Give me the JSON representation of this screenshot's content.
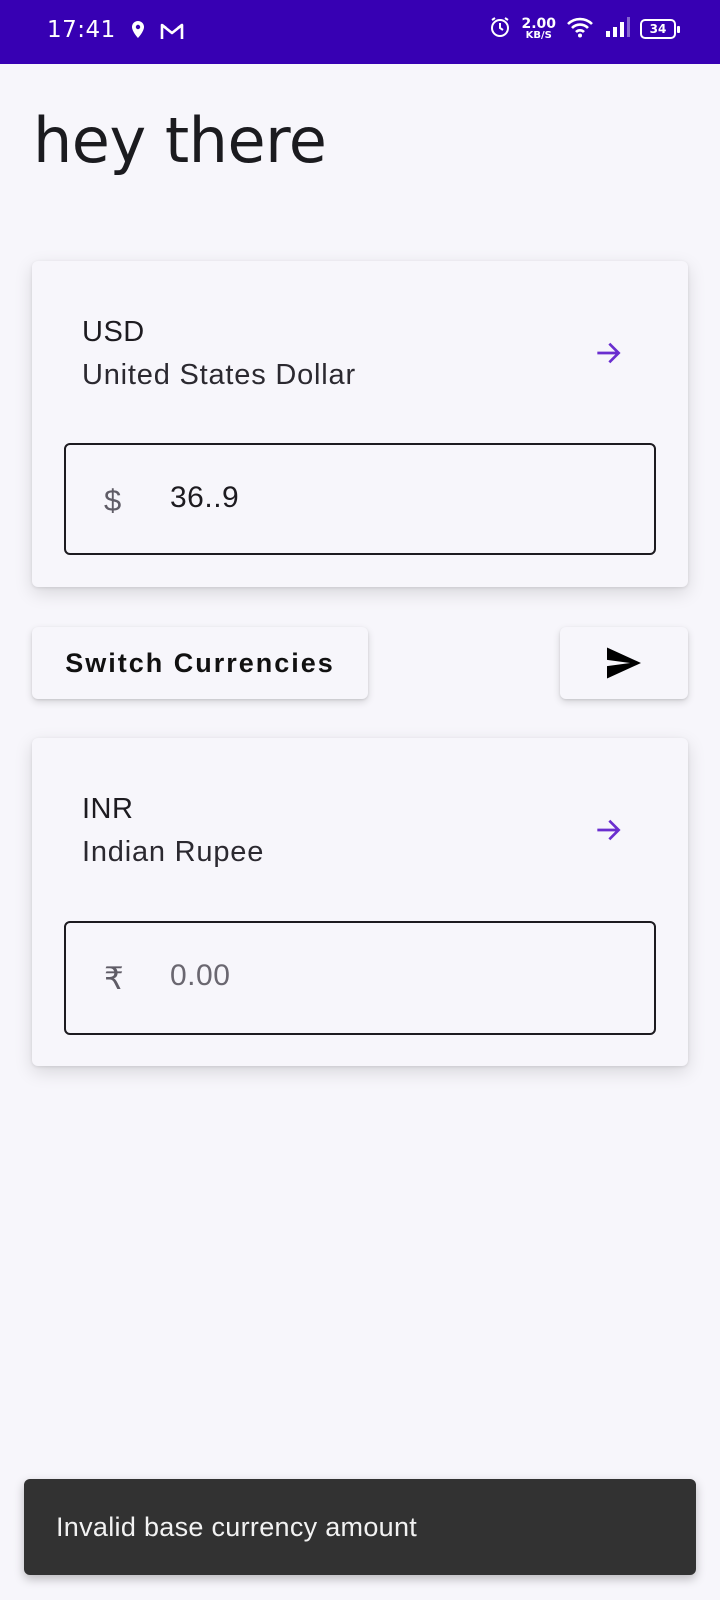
{
  "status_bar": {
    "time": "17:41",
    "speed_value": "2.00",
    "speed_unit": "KB/S",
    "battery": "34",
    "icons": [
      "location-icon",
      "gmail-icon",
      "alarm-icon",
      "wifi-icon",
      "signal-icon",
      "battery-icon"
    ]
  },
  "greeting": "hey there",
  "base_card": {
    "code": "USD",
    "name": "United States Dollar",
    "symbol": "$",
    "amount": "36..9"
  },
  "actions": {
    "switch_label": "Switch Currencies"
  },
  "target_card": {
    "code": "INR",
    "name": "Indian Rupee",
    "symbol": "₹",
    "amount_placeholder": "0.00"
  },
  "snackbar": {
    "message": "Invalid base currency amount"
  },
  "colors": {
    "status_bar": "#3700b3",
    "accent": "#6a2ecf",
    "background": "#f7f6fb",
    "snackbar": "#323232"
  }
}
